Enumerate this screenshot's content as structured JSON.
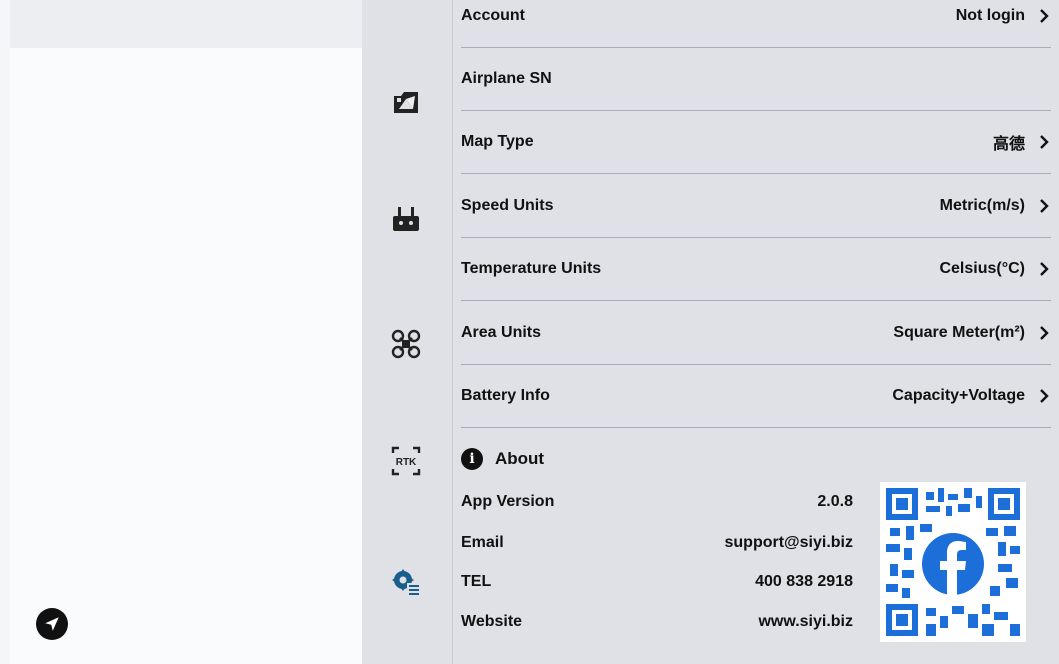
{
  "top_partial": {
    "label": "Account",
    "value": "Not login"
  },
  "settings": [
    {
      "label": "Airplane SN",
      "value": "",
      "has_chevron": false
    },
    {
      "label": "Map Type",
      "value": "高德",
      "has_chevron": true
    },
    {
      "label": "Speed Units",
      "value": "Metric(m/s)",
      "has_chevron": true
    },
    {
      "label": "Temperature Units",
      "value": "Celsius(°C)",
      "has_chevron": true
    },
    {
      "label": "Area Units",
      "value": "Square Meter(m²)",
      "has_chevron": true
    },
    {
      "label": "Battery Info",
      "value": "Capacity+Voltage",
      "has_chevron": true
    }
  ],
  "about": {
    "title": "About",
    "rows": [
      {
        "label": "App Version",
        "value": "2.0.8"
      },
      {
        "label": "Email",
        "value": "support@siyi.biz"
      },
      {
        "label": "TEL",
        "value": "400 838 2918"
      },
      {
        "label": "Website",
        "value": "www.siyi.biz"
      }
    ]
  },
  "nav_icons": [
    "camera-settings-icon",
    "remote-controller-icon",
    "drone-icon",
    "rtk-icon",
    "general-settings-icon"
  ],
  "rtk_label": "RTK",
  "colors": {
    "panel": "#dfe1e6",
    "divider": "#a9acb2",
    "accent": "#1a73c8",
    "text": "#111111"
  }
}
